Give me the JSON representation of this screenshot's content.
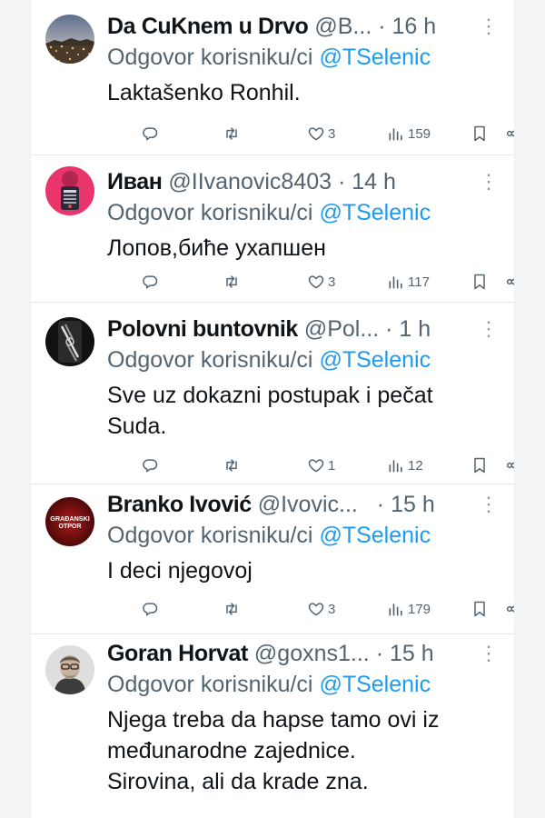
{
  "reply_prefix": "Odgovor korisniku/ci",
  "mention": "@TSelenic",
  "more_label": "· · ·",
  "tweets": [
    {
      "name": "Da CuKnem u Drvo",
      "handle": "@B...",
      "dot": "·",
      "time": "16 h",
      "lines": [
        "Laktašenko Ronhil."
      ],
      "likes": "3",
      "views": "159"
    },
    {
      "name": "Иван",
      "handle": "@IIvanovic8403",
      "dot": "·",
      "time": "14 h",
      "lines": [
        "Лопов,бићe ухапшен"
      ],
      "likes": "3",
      "views": "117"
    },
    {
      "name": "Polovni buntovnik",
      "handle": "@Pol...",
      "dot": "·",
      "time": "1 h",
      "lines": [
        "Sve uz dokazni postupak i pečat",
        "Suda."
      ],
      "likes": "1",
      "views": "12"
    },
    {
      "name": "Branko Ivović",
      "handle": "@Ivovic...",
      "dot": "·",
      "time": "15 h",
      "lines": [
        "I deci njegovoj"
      ],
      "likes": "3",
      "views": "179",
      "avatar_text": [
        "GRAĐANSKI",
        "OTPOR"
      ]
    },
    {
      "name": "Goran Horvat",
      "handle": "@goxns1...",
      "dot": "·",
      "time": "15 h",
      "lines": [
        "Njega treba da hapse tamo ovi iz",
        "međunarodne zajednice.",
        "Sirovina, ali da krade zna."
      ]
    }
  ],
  "icons": {
    "reply": "reply-icon",
    "retweet": "retweet-icon",
    "like": "heart-icon",
    "views": "views-icon",
    "bookmark": "bookmark-icon",
    "share": "share-icon"
  },
  "colors": {
    "text": "#0f1419",
    "secondary": "#536471",
    "link": "#1d9bf0",
    "divider": "#e4e7ea"
  }
}
